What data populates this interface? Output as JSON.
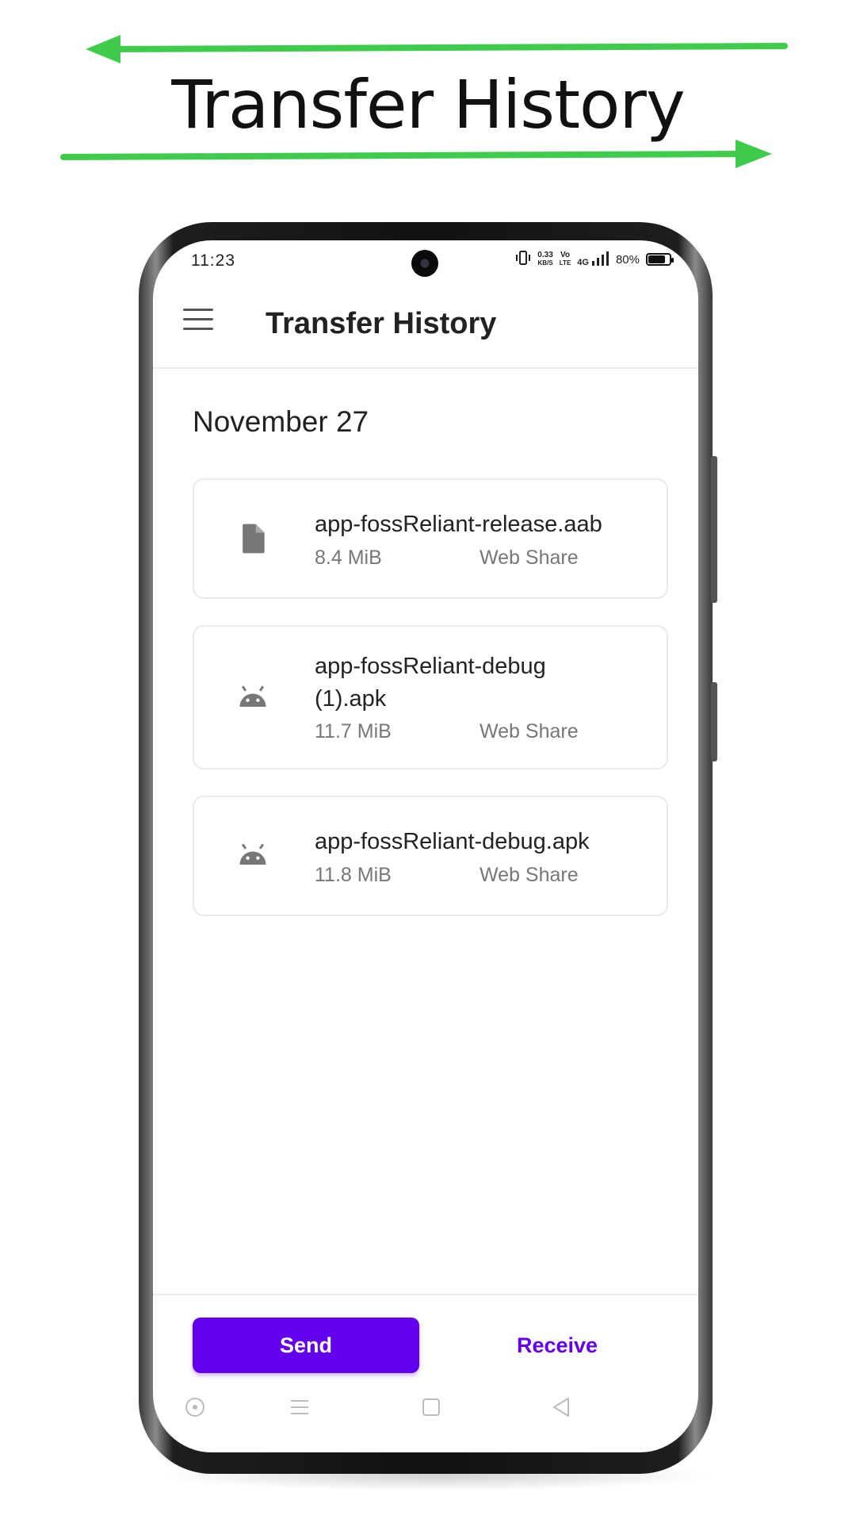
{
  "promo": {
    "title": "Transfer History",
    "arrow_color": "#3fcc4c"
  },
  "status_bar": {
    "time": "11:23",
    "net_speed": "0.33",
    "net_unit": "KB/S",
    "volte_top": "Vo",
    "volte_bottom": "LTE",
    "network": "4G",
    "battery": "80%"
  },
  "app_bar": {
    "menu_icon": "menu-icon",
    "title": "Transfer History"
  },
  "history": {
    "date": "November 27",
    "items": [
      {
        "icon": "file-icon",
        "name": "app-fossReliant-release.aab",
        "size": "8.4 MiB",
        "method": "Web Share"
      },
      {
        "icon": "android-icon",
        "name": "app-fossReliant-debug (1).apk",
        "size": "11.7 MiB",
        "method": "Web Share"
      },
      {
        "icon": "android-icon",
        "name": "app-fossReliant-debug.apk",
        "size": "11.8 MiB",
        "method": "Web Share"
      }
    ]
  },
  "actions": {
    "send_label": "Send",
    "receive_label": "Receive",
    "accent_color": "#6200ee"
  },
  "system_nav": [
    "record-icon",
    "recents-icon",
    "home-icon",
    "back-icon"
  ]
}
